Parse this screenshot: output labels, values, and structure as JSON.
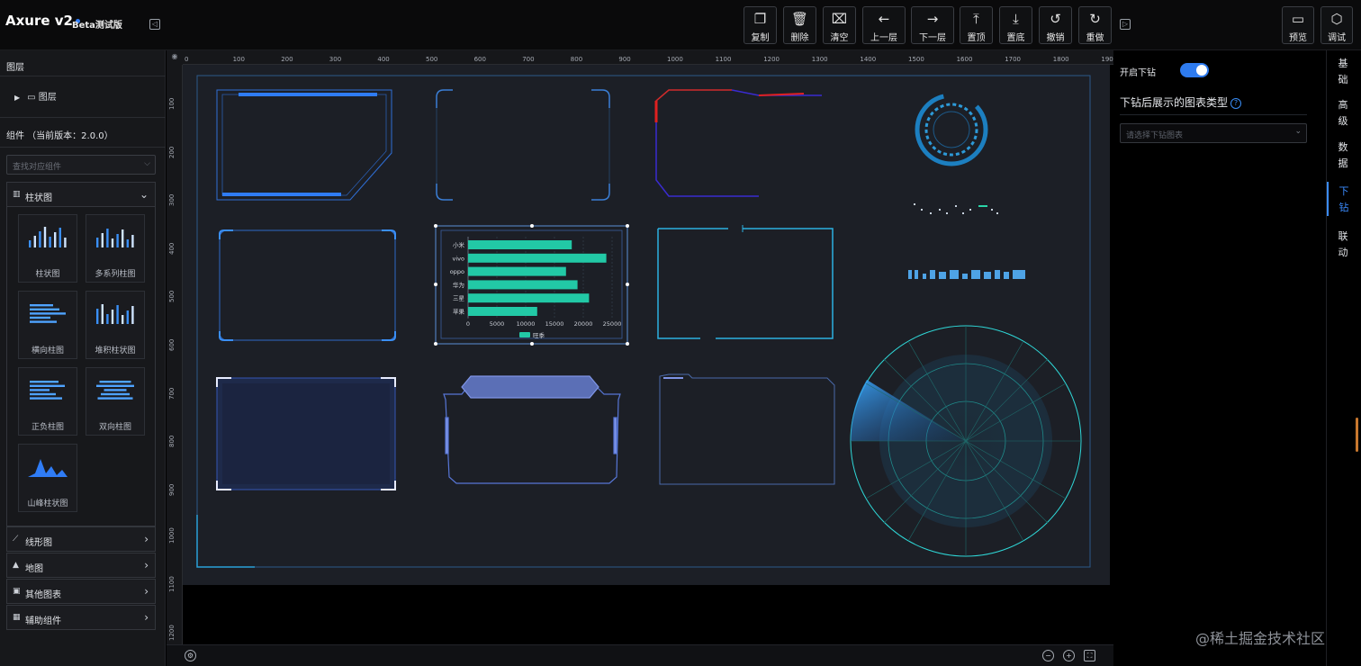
{
  "app": {
    "title": "Axure v2",
    "badge": "Beta测试版"
  },
  "toolbar": [
    {
      "id": "copy",
      "icon": "copy-icon",
      "glyph": "❐",
      "label": "复制"
    },
    {
      "id": "delete",
      "icon": "trash-icon",
      "glyph": "🗑",
      "label": "删除"
    },
    {
      "id": "clear",
      "icon": "clear-icon",
      "glyph": "⌧",
      "label": "清空"
    },
    {
      "id": "layer-up",
      "icon": "layer-up-icon",
      "glyph": "←",
      "label": "上一层"
    },
    {
      "id": "layer-down",
      "icon": "layer-down-icon",
      "glyph": "→",
      "label": "下一层"
    },
    {
      "id": "top",
      "icon": "bring-top-icon",
      "glyph": "⤒",
      "label": "置顶"
    },
    {
      "id": "bottom",
      "icon": "send-bottom-icon",
      "glyph": "⤓",
      "label": "置底"
    },
    {
      "id": "undo",
      "icon": "undo-icon",
      "glyph": "↺",
      "label": "撤销"
    },
    {
      "id": "redo",
      "icon": "redo-icon",
      "glyph": "↻",
      "label": "重做"
    }
  ],
  "toolbar_right": [
    {
      "id": "preview",
      "icon": "monitor-icon",
      "glyph": "▭",
      "label": "预览"
    },
    {
      "id": "debug",
      "icon": "cube-icon",
      "glyph": "⬡",
      "label": "调试"
    }
  ],
  "left": {
    "layers_title": "图层",
    "layer_item": "图层",
    "components_title": "组件 （当前版本：2.0.0）",
    "search_placeholder": "查找对应组件",
    "open_category": "柱状图",
    "tiles": [
      "柱状图",
      "多系列柱图",
      "横向柱图",
      "堆积柱状图",
      "正负柱图",
      "双向柱图",
      "山峰柱状图"
    ],
    "categories": [
      {
        "icon": "line-chart-icon",
        "glyph": "⟋",
        "label": "线形图"
      },
      {
        "icon": "map-icon",
        "glyph": "▲",
        "label": "地图"
      },
      {
        "icon": "other-chart-icon",
        "glyph": "▣",
        "label": "其他图表"
      },
      {
        "icon": "helper-icon",
        "glyph": "▦",
        "label": "辅助组件"
      }
    ]
  },
  "ruler": {
    "h": [
      "0",
      "100",
      "200",
      "300",
      "400",
      "500",
      "600",
      "700",
      "800",
      "900",
      "1000",
      "1100",
      "1200",
      "1300",
      "1400",
      "1500",
      "1600",
      "1700",
      "1800",
      "190"
    ],
    "v": [
      "100",
      "200",
      "300",
      "400",
      "500",
      "600",
      "700",
      "800",
      "900",
      "1000",
      "1100",
      "1200"
    ]
  },
  "chart_data": {
    "type": "bar",
    "orientation": "horizontal",
    "categories": [
      "小米",
      "vivo",
      "oppo",
      "华为",
      "三星",
      "苹果"
    ],
    "series": [
      {
        "name": "旺季",
        "values": [
          18000,
          24000,
          17000,
          19000,
          21000,
          12000
        ]
      }
    ],
    "xlim": [
      0,
      25000
    ],
    "xticks": [
      "0",
      "5000",
      "10000",
      "15000",
      "20000",
      "25000"
    ],
    "color": "#22c9a6",
    "legend": "bottom",
    "grid": true
  },
  "right": {
    "drill_label": "开启下钻",
    "drill_enabled": true,
    "chart_type_label": "下钻后展示的图表类型",
    "select_placeholder": "请选择下钻图表",
    "tabs": [
      "基础",
      "高级",
      "数据",
      "下钻",
      "联动"
    ],
    "active_tab": "下钻"
  },
  "watermark": "@稀土掘金技术社区",
  "colors": {
    "accent": "#2e7bef",
    "board": "#1c1f26",
    "teal": "#22c9a6"
  }
}
